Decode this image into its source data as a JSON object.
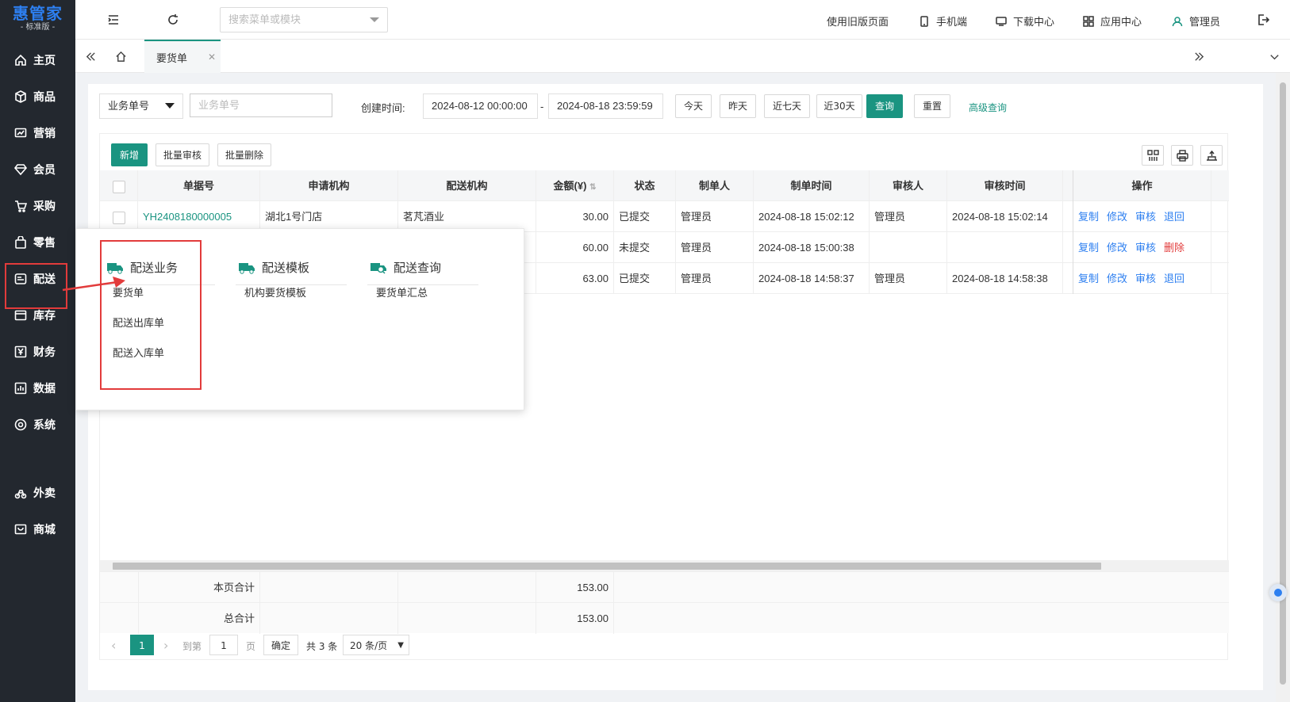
{
  "brand": {
    "name": "惠管家",
    "edition": "- 标准版 -",
    "color": "#2d7ff0"
  },
  "sidebar": {
    "items": [
      {
        "label": "主页",
        "icon": "home-icon"
      },
      {
        "label": "商品",
        "icon": "box-icon"
      },
      {
        "label": "营销",
        "icon": "chart-icon"
      },
      {
        "label": "会员",
        "icon": "diamond-icon"
      },
      {
        "label": "采购",
        "icon": "cart-icon"
      },
      {
        "label": "零售",
        "icon": "bag-icon"
      },
      {
        "label": "配送",
        "icon": "delivery-icon"
      },
      {
        "label": "库存",
        "icon": "inventory-icon"
      },
      {
        "label": "财务",
        "icon": "yen-icon"
      },
      {
        "label": "数据",
        "icon": "data-icon"
      },
      {
        "label": "系统",
        "icon": "settings-icon"
      },
      {
        "label": "外卖",
        "icon": "bike-icon"
      },
      {
        "label": "商城",
        "icon": "shop-icon"
      }
    ]
  },
  "topbar": {
    "search_placeholder": "搜索菜单或模块",
    "old_version": "使用旧版页面",
    "mobile": "手机端",
    "download": "下载中心",
    "apps": "应用中心",
    "user": "管理员"
  },
  "tabs": {
    "active": "要货单"
  },
  "filter": {
    "field_select": "业务单号",
    "field_placeholder": "业务单号",
    "created_label": "创建时间:",
    "date_from": "2024-08-12 00:00:00",
    "date_sep": "-",
    "date_to": "2024-08-18 23:59:59",
    "btn_today": "今天",
    "btn_yesterday": "昨天",
    "btn_7days": "近七天",
    "btn_30days": "近30天",
    "btn_query": "查询",
    "btn_reset": "重置",
    "advanced": "高级查询"
  },
  "actions": {
    "add": "新增",
    "batch_audit": "批量审核",
    "batch_delete": "批量删除"
  },
  "table": {
    "headers": {
      "order_no": "单据号",
      "applicant": "申请机构",
      "distributor": "配送机构",
      "amount": "金额(¥)",
      "status": "状态",
      "creator": "制单人",
      "created_at": "制单时间",
      "auditor": "审核人",
      "audit_time": "审核时间",
      "ops": "操作"
    },
    "rows": [
      {
        "order_no": "YH2408180000005",
        "applicant": "湖北1号门店",
        "distributor": "茗芃酒业",
        "amount": "30.00",
        "status": "已提交",
        "creator": "管理员",
        "created_at": "2024-08-18 15:02:12",
        "auditor": "管理员",
        "audit_time": "2024-08-18 15:02:14",
        "ops": [
          "复制",
          "修改",
          "审核",
          "退回"
        ]
      },
      {
        "order_no": "",
        "applicant": "",
        "distributor": "",
        "amount": "60.00",
        "status": "未提交",
        "creator": "管理员",
        "created_at": "2024-08-18 15:00:38",
        "auditor": "",
        "audit_time": "",
        "ops": [
          "复制",
          "修改",
          "审核",
          "删除"
        ]
      },
      {
        "order_no": "",
        "applicant": "",
        "distributor": "",
        "amount": "63.00",
        "status": "已提交",
        "creator": "管理员",
        "created_at": "2024-08-18 14:58:37",
        "auditor": "管理员",
        "audit_time": "2024-08-18 14:58:38",
        "ops": [
          "复制",
          "修改",
          "审核",
          "退回"
        ]
      }
    ],
    "page_total_label": "本页合计",
    "page_total": "153.00",
    "grand_total_label": "总合计",
    "grand_total": "153.00"
  },
  "pager": {
    "current": "1",
    "goto_label": "到第",
    "goto_value": "1",
    "page_unit": "页",
    "confirm": "确定",
    "total": "共 3 条",
    "page_size": "20 条/页"
  },
  "popup": {
    "columns": [
      {
        "title": "配送业务",
        "items": [
          "要货单",
          "配送出库单",
          "配送入库单"
        ]
      },
      {
        "title": "配送模板",
        "items": [
          "机构要货模板"
        ]
      },
      {
        "title": "配送查询",
        "items": [
          "要货单汇总"
        ]
      }
    ]
  },
  "colors": {
    "accent": "#1a9481",
    "sidebar": "#23282f",
    "highlight": "#e23b3b",
    "link": "#2d7ff0"
  }
}
